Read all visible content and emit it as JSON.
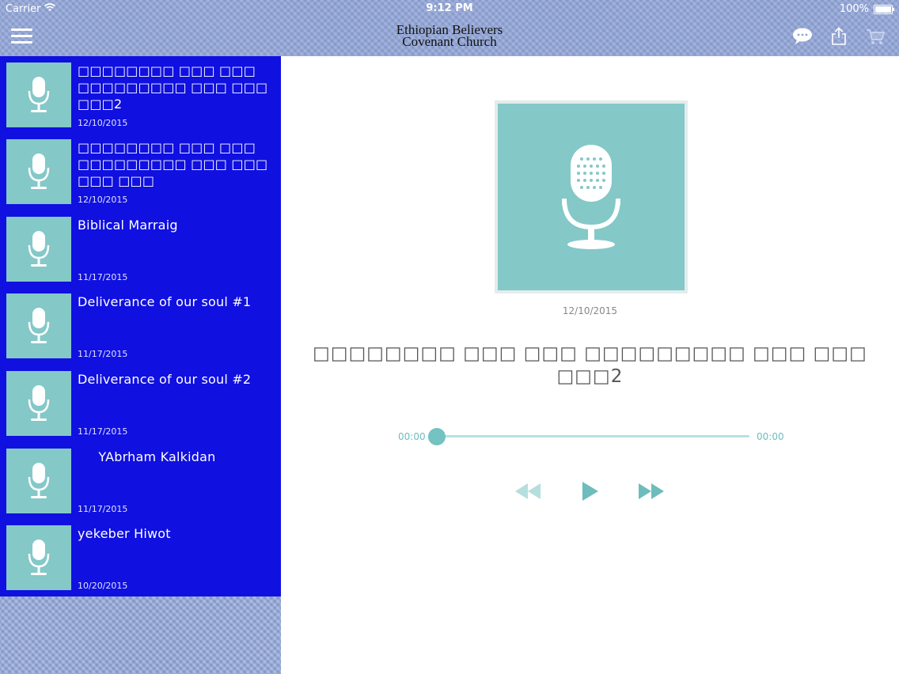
{
  "status_bar": {
    "carrier": "Carrier",
    "time": "9:12 PM",
    "battery": "100%"
  },
  "nav": {
    "title_line1": "Ethiopian Believers",
    "title_line2": "Covenant Church"
  },
  "sidebar": {
    "items": [
      {
        "title": "□□□□□□□□ □□□ □□□ □□□□□□□□□ □□□ □□□ □□□2",
        "date": "12/10/2015"
      },
      {
        "title": "□□□□□□□□ □□□ □□□ □□□□□□□□□ □□□ □□□ □□□ □□□",
        "date": "12/10/2015"
      },
      {
        "title": "Biblical Marraig",
        "date": "11/17/2015"
      },
      {
        "title": "Deliverance of our soul #1",
        "date": "11/17/2015"
      },
      {
        "title": "Deliverance of our soul #2",
        "date": "11/17/2015"
      },
      {
        "title": "     YAbrham Kalkidan",
        "date": "11/17/2015"
      },
      {
        "title": "yekeber Hiwot",
        "date": "10/20/2015"
      }
    ]
  },
  "player": {
    "date": "12/10/2015",
    "title": "□□□□□□□□ □□□ □□□ □□□□□□□□□ □□□ □□□ □□□2",
    "time_elapsed": "00:00",
    "time_total": "00:00",
    "progress": 0
  },
  "colors": {
    "list_bg": "#1010e0",
    "accent": "#84c8c8",
    "nav_bg": "#8fa3d6"
  },
  "icons": [
    "wifi-icon",
    "battery-icon",
    "menu-icon",
    "chat-icon",
    "share-icon",
    "cart-icon",
    "microphone-icon",
    "rewind-icon",
    "play-icon",
    "fast-forward-icon"
  ]
}
